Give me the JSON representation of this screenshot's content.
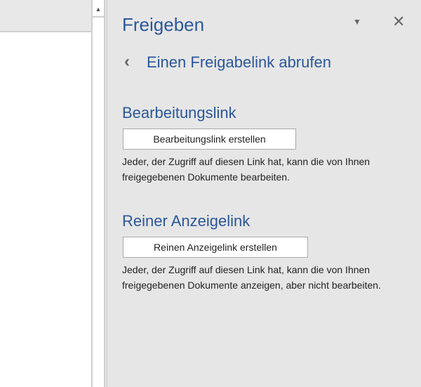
{
  "panel": {
    "title": "Freigeben",
    "back_label": "Einen Freigabelink abrufen"
  },
  "edit": {
    "heading": "Bearbeitungslink",
    "button": "Bearbeitungslink erstellen",
    "desc": "Jeder, der Zugriff auf diesen Link hat, kann die von Ihnen freigegebenen Dokumente bearbeiten."
  },
  "view": {
    "heading": "Reiner Anzeigelink",
    "button": "Reinen Anzeigelink erstellen",
    "desc": "Jeder, der Zugriff auf diesen Link hat, kann die von Ihnen freigegebenen Dokumente anzeigen, aber nicht bearbeiten."
  },
  "icons": {
    "dropdown": "▼",
    "close": "✕",
    "back": "‹",
    "scroll_up": "▲"
  }
}
